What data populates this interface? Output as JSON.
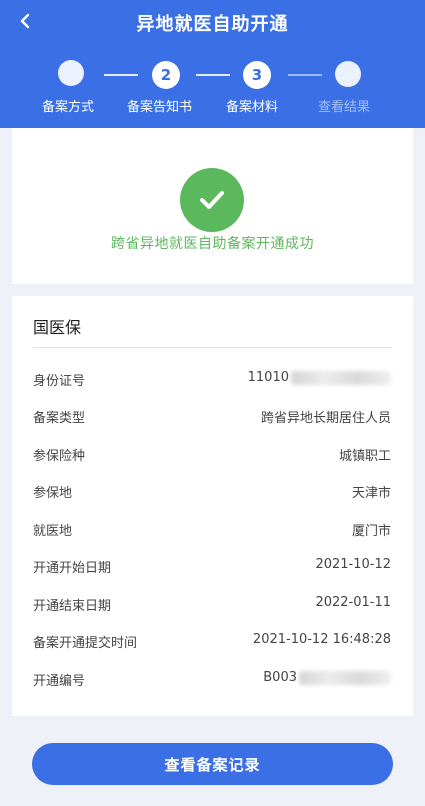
{
  "header": {
    "title": "异地就医自助开通",
    "back_icon": "back-arrow-icon"
  },
  "steps": [
    {
      "number": "",
      "label": "备案方式"
    },
    {
      "number": "2",
      "label": "备案告知书"
    },
    {
      "number": "3",
      "label": "备案材料"
    },
    {
      "number": "",
      "label": "查看结果"
    }
  ],
  "result": {
    "icon": "check-icon",
    "message": "跨省异地就医自助备案开通成功"
  },
  "info": {
    "section_title": "国医保",
    "rows": [
      {
        "label": "身份证号",
        "value": "11010"
      },
      {
        "label": "备案类型",
        "value": "跨省异地长期居住人员"
      },
      {
        "label": "参保险种",
        "value": "城镇职工"
      },
      {
        "label": "参保地",
        "value": "天津市"
      },
      {
        "label": "就医地",
        "value": "厦门市"
      },
      {
        "label": "开通开始日期",
        "value": "2021-10-12"
      },
      {
        "label": "开通结束日期",
        "value": "2022-01-11"
      },
      {
        "label": "备案开通提交时间",
        "value": "2021-10-12  16:48:28"
      },
      {
        "label": "开通编号",
        "value": "B003"
      }
    ]
  },
  "footer": {
    "button_label": "查看备案记录"
  },
  "colors": {
    "primary": "#3a6fe6",
    "success": "#5cb85c"
  }
}
